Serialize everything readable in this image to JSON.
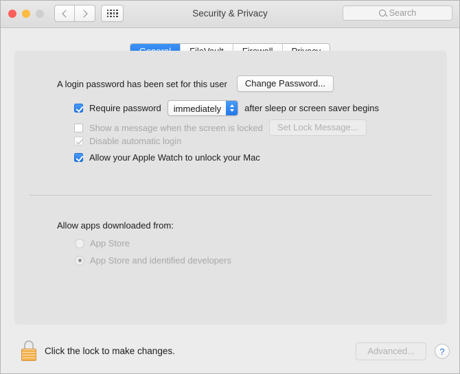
{
  "window": {
    "title": "Security & Privacy",
    "traffic_lights": [
      "close",
      "minimize",
      "zoom"
    ],
    "nav": {
      "back_icon": "chevron-left-icon",
      "forward_icon": "chevron-right-icon",
      "grid_icon": "show-all-grid-icon"
    },
    "search": {
      "placeholder": "Search",
      "value": "",
      "icon": "search-icon"
    }
  },
  "tabs": [
    {
      "label": "General",
      "active": true
    },
    {
      "label": "FileVault",
      "active": false
    },
    {
      "label": "Firewall",
      "active": false
    },
    {
      "label": "Privacy",
      "active": false
    }
  ],
  "general": {
    "login_password_text": "A login password has been set for this user",
    "change_password_button": "Change Password...",
    "require_password": {
      "label": "Require password",
      "checked": true,
      "interval_value": "immediately",
      "suffix": "after sleep or screen saver begins"
    },
    "show_message": {
      "label": "Show a message when the screen is locked",
      "checked": false,
      "enabled": false,
      "button": "Set Lock Message...",
      "button_enabled": false
    },
    "disable_auto_login": {
      "label": "Disable automatic login",
      "checked": true,
      "enabled": false
    },
    "apple_watch": {
      "label": "Allow your Apple Watch to unlock your Mac",
      "checked": true,
      "enabled": true
    },
    "download_section": {
      "heading": "Allow apps downloaded from:",
      "options": [
        {
          "label": "App Store",
          "selected": false
        },
        {
          "label": "App Store and identified developers",
          "selected": true
        }
      ],
      "enabled": false
    }
  },
  "footer": {
    "lock_icon": "closed-padlock-icon",
    "lock_text": "Click the lock to make changes.",
    "advanced_button": "Advanced...",
    "advanced_enabled": false,
    "help_button": "?"
  },
  "colors": {
    "accent_blue": "#2179e8",
    "window_bg": "#ececec",
    "panel_bg": "#e3e3e3",
    "lock_gold": "#f2b04b",
    "close_red": "#fc605c",
    "min_yellow": "#fdbc40",
    "zoom_gray": "#cfcfcf"
  }
}
